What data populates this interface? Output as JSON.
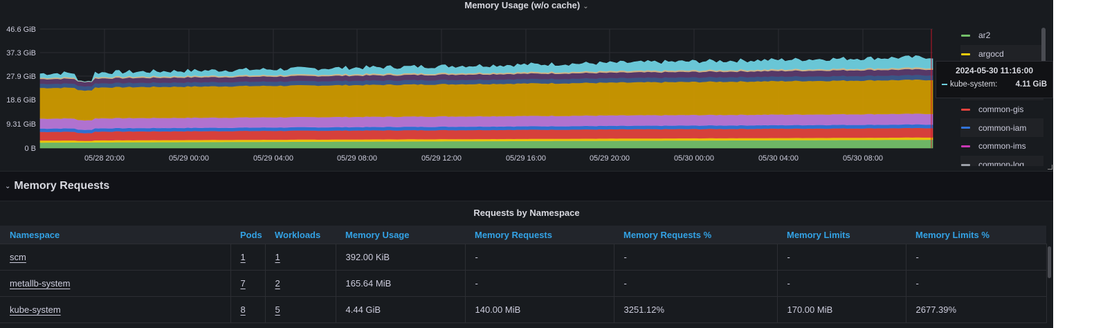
{
  "chart_panel": {
    "title": "Memory Usage (w/o cache)",
    "caret_icon": "chevron-down-icon"
  },
  "chart_data": {
    "type": "area",
    "stacked": true,
    "title": "Memory Usage (w/o cache)",
    "y_ticks": [
      "46.6 GiB",
      "37.3 GiB",
      "27.9 GiB",
      "18.6 GiB",
      "9.31 GiB",
      "0 B"
    ],
    "ylim": [
      0,
      46.6
    ],
    "y_unit": "GiB",
    "x_ticks": [
      "05/28 20:00",
      "05/29 00:00",
      "05/29 04:00",
      "05/29 08:00",
      "05/29 12:00",
      "05/29 16:00",
      "05/29 20:00",
      "05/30 00:00",
      "05/30 04:00",
      "05/30 08:00"
    ],
    "grid": true,
    "legend_placement": "right",
    "series": [
      {
        "name": "ar2",
        "color": "#73bf69",
        "start": 2.2,
        "end": 3.3
      },
      {
        "name": "argocd",
        "color": "#f2cc0c",
        "start": 0.8,
        "end": 0.9
      },
      {
        "name": "common-gis",
        "color": "#e0423d",
        "start": 3.4,
        "end": 3.7
      },
      {
        "name": "common-iam",
        "color": "#3274d9",
        "start": 1.3,
        "end": 1.4
      },
      {
        "name": "common-ims",
        "color": "#b877d9",
        "start": 3.9,
        "end": 4.2
      },
      {
        "name": "common-log",
        "color": "#cc9900",
        "start": 12.0,
        "end": 13.3
      },
      {
        "name": "",
        "color": "#3b5a8c",
        "start": 1.6,
        "end": 1.8
      },
      {
        "name": "",
        "color": "#5a3a6b",
        "start": 1.9,
        "end": 2.3
      },
      {
        "name": "",
        "color": "#d7b98a",
        "start": 0.5,
        "end": 0.6
      },
      {
        "name": "kube-system",
        "color": "#6ed0e0",
        "start": 1.5,
        "end": 4.1
      }
    ]
  },
  "legend": {
    "items": [
      {
        "label": "ar2",
        "color": "#73bf69"
      },
      {
        "label": "argocd",
        "color": "#f2cc0c"
      },
      {
        "label": "",
        "color": "#ff9830"
      },
      {
        "label": "",
        "color": "#ccccdc"
      },
      {
        "label": "common-gis",
        "color": "#e0423d"
      },
      {
        "label": "common-iam",
        "color": "#3274d9"
      },
      {
        "label": "common-ims",
        "color": "#c837b3"
      },
      {
        "label": "common-log",
        "color": "#9ca0a8"
      }
    ]
  },
  "tooltip": {
    "time": "2024-05-30 11:16:00",
    "series": "kube-system:",
    "value": "4.11 GiB",
    "color": "#6ed0e0"
  },
  "row": {
    "title": "Memory Requests",
    "icon": "chevron-down-icon"
  },
  "table": {
    "title": "Requests by Namespace",
    "columns": [
      "Namespace",
      "Pods",
      "Workloads",
      "Memory Usage",
      "Memory Requests",
      "Memory Requests %",
      "Memory Limits",
      "Memory Limits %"
    ],
    "rows": [
      {
        "namespace": "scm",
        "pods": "1",
        "workloads": "1",
        "mem_usage": "392.00 KiB",
        "mem_requests": "-",
        "mem_requests_pct": "-",
        "mem_limits": "-",
        "mem_limits_pct": "-"
      },
      {
        "namespace": "metallb-system",
        "pods": "7",
        "workloads": "2",
        "mem_usage": "165.64 MiB",
        "mem_requests": "-",
        "mem_requests_pct": "-",
        "mem_limits": "-",
        "mem_limits_pct": "-"
      },
      {
        "namespace": "kube-system",
        "pods": "8",
        "workloads": "5",
        "mem_usage": "4.44 GiB",
        "mem_requests": "140.00 MiB",
        "mem_requests_pct": "3251.12%",
        "mem_limits": "170.00 MiB",
        "mem_limits_pct": "2677.39%"
      }
    ]
  }
}
